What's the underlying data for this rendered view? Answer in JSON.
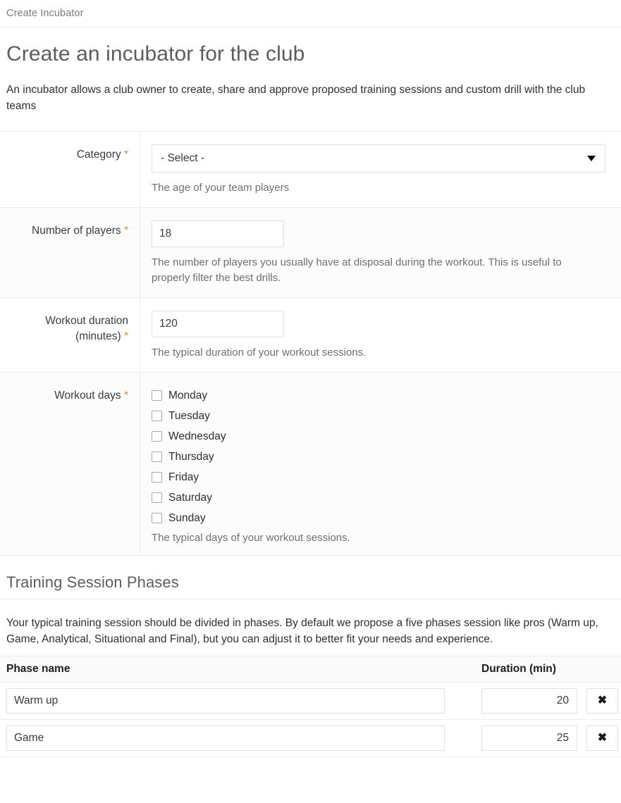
{
  "breadcrumb": {
    "label": "Create Incubator"
  },
  "page": {
    "title": "Create an incubator for the club",
    "intro": "An incubator allows a club owner to create, share and approve proposed training sessions and custom drill with the club teams"
  },
  "form": {
    "required_mark": "*",
    "category": {
      "label": "Category",
      "selected": "- Select -",
      "description": "The age of your team players"
    },
    "players": {
      "label": "Number of players",
      "value": "18",
      "description": "The number of players you usually have at disposal during the workout. This is useful to properly filter the best drills."
    },
    "duration": {
      "label_line1": "Workout duration",
      "label_line2": "(minutes)",
      "value": "120",
      "description": "The typical duration of your workout sessions."
    },
    "days": {
      "label": "Workout days",
      "options": [
        {
          "label": "Monday",
          "checked": false
        },
        {
          "label": "Tuesday",
          "checked": false
        },
        {
          "label": "Wednesday",
          "checked": false
        },
        {
          "label": "Thursday",
          "checked": false
        },
        {
          "label": "Friday",
          "checked": false
        },
        {
          "label": "Saturday",
          "checked": false
        },
        {
          "label": "Sunday",
          "checked": false
        }
      ],
      "description": "The typical days of your workout sessions."
    }
  },
  "phases_section": {
    "title": "Training Session Phases",
    "intro": "Your typical training session should be divided in phases. By default we propose a five phases session like pros (Warm up, Game, Analytical, Situational and Final), but you can adjust it to better fit your needs and experience.",
    "columns": {
      "name": "Phase name",
      "duration": "Duration (min)"
    },
    "remove_icon": "✖",
    "rows": [
      {
        "name": "Warm up",
        "duration": "20"
      },
      {
        "name": "Game",
        "duration": "25"
      }
    ]
  },
  "colors": {
    "required_asterisk": "#e8883a",
    "heading": "#5d5d5d",
    "border": "#ededed",
    "input_border": "#dcdfe6",
    "stripe": "#fcfcfc",
    "table_header_bg": "#fafafa"
  }
}
